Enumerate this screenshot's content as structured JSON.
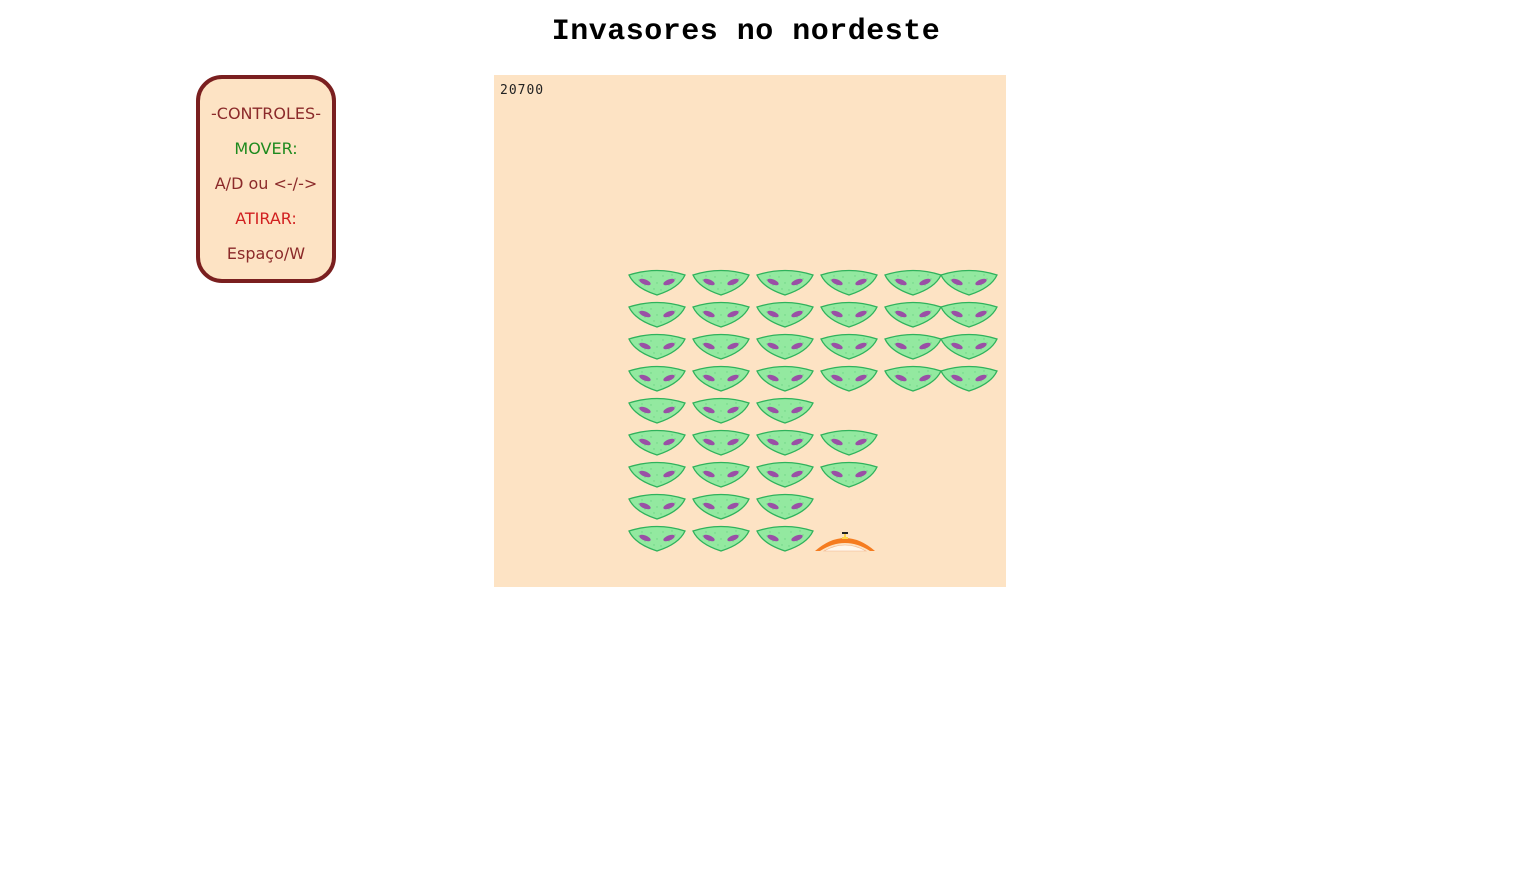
{
  "page": {
    "title": "Invasores no nordeste"
  },
  "controls": {
    "heading": "-CONTROLES-",
    "move_label": "MOVER:",
    "move_keys": "A/D ou <-/->",
    "fire_label": "ATIRAR:",
    "fire_keys": "Espaço/W"
  },
  "game": {
    "score": "20700",
    "colors": {
      "background": "#fde3c4",
      "alien_body": "#93e9a0",
      "alien_outline": "#2fb25c",
      "alien_eyes": "#9a4fa6",
      "player": "#f57c20"
    },
    "alien_formation": [
      [
        1,
        1,
        1,
        1,
        1,
        1
      ],
      [
        1,
        1,
        1,
        1,
        1,
        1
      ],
      [
        1,
        1,
        1,
        1,
        1,
        1
      ],
      [
        1,
        1,
        1,
        1,
        1,
        1
      ],
      [
        1,
        1,
        1,
        0,
        0,
        0
      ],
      [
        1,
        1,
        1,
        1,
        0,
        0
      ],
      [
        1,
        1,
        1,
        1,
        0,
        0
      ],
      [
        1,
        1,
        1,
        0,
        0,
        0
      ],
      [
        1,
        1,
        1,
        0,
        0,
        0
      ]
    ],
    "alien_icon": "alien-invader-icon",
    "player_icon": "player-cannon-icon"
  }
}
